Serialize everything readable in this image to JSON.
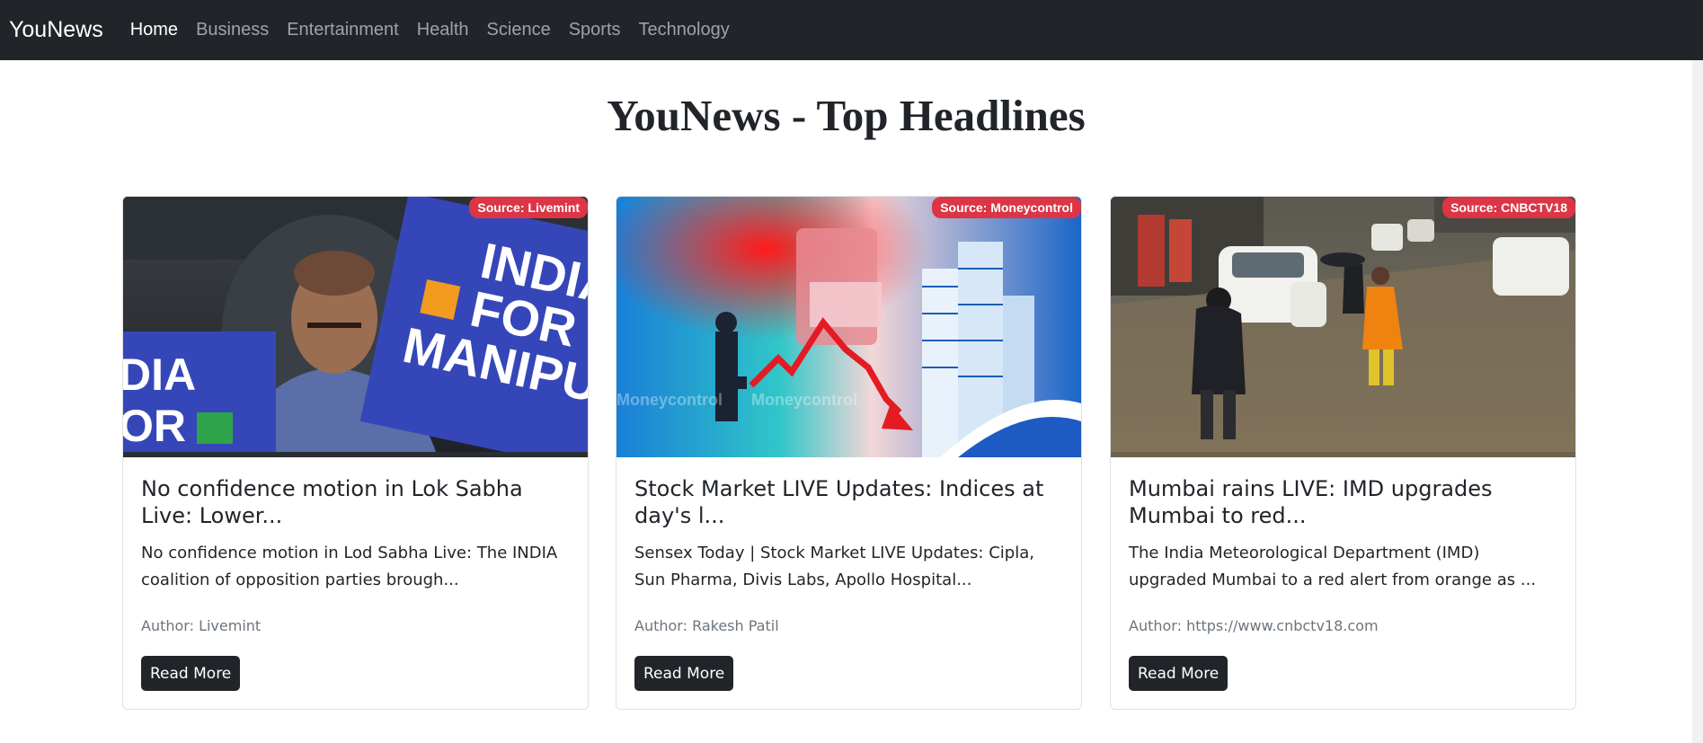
{
  "nav": {
    "brand": "YouNews",
    "items": [
      {
        "label": "Home",
        "active": true
      },
      {
        "label": "Business",
        "active": false
      },
      {
        "label": "Entertainment",
        "active": false
      },
      {
        "label": "Health",
        "active": false
      },
      {
        "label": "Science",
        "active": false
      },
      {
        "label": "Sports",
        "active": false
      },
      {
        "label": "Technology",
        "active": false
      }
    ]
  },
  "page": {
    "title": "YouNews - Top Headlines"
  },
  "cards": [
    {
      "source": "Source: Livemint",
      "title": "No confidence motion in Lok Sabha Live: Lower...",
      "text": "No confidence motion in Lod Sabha Live: The INDIA coalition of opposition parties brough...",
      "author": "Author: Livemint",
      "button": "Read More"
    },
    {
      "source": "Source: Moneycontrol",
      "title": "Stock Market LIVE Updates: Indices at day's l...",
      "text": "Sensex Today | Stock Market LIVE Updates: Cipla, Sun Pharma, Divis Labs, Apollo Hospital...",
      "author": "Author: Rakesh Patil",
      "button": "Read More"
    },
    {
      "source": "Source: CNBCTV18",
      "title": "Mumbai rains LIVE: IMD upgrades Mumbai to red...",
      "text": "The India Meteorological Department (IMD) upgraded Mumbai to a red alert from orange as ...",
      "author": "Author: https://www.cnbctv18.com",
      "button": "Read More"
    }
  ],
  "images": {
    "card0": {
      "sign_text_1": "INDIA",
      "sign_text_2": "FOR",
      "sign_text_3": "MANIPUR",
      "sign_left_1": "DIA",
      "sign_left_2": "OR"
    },
    "card1": {
      "watermark": "Moneycontrol"
    }
  },
  "colors": {
    "navbar": "#212529",
    "badge": "#dc3545",
    "button": "#212529"
  }
}
